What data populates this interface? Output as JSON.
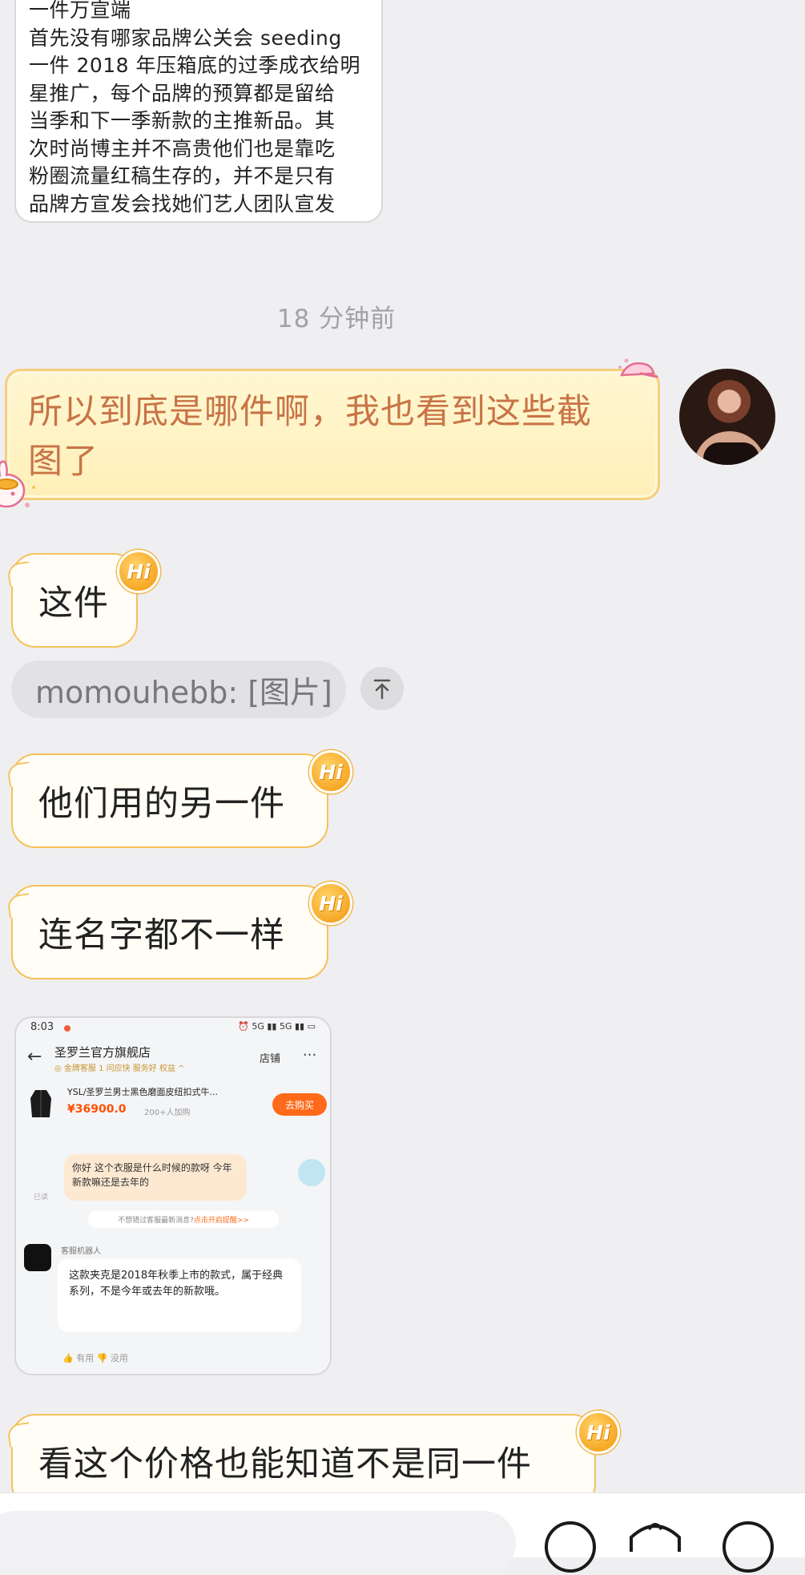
{
  "messages": {
    "screenshot_text_lines": [
      "一件万宣端",
      "首先没有哪家品牌公关会 seeding",
      "一件 2018 年压箱底的过季成衣给明",
      "星推广，每个品牌的预算都是留给",
      "当季和下一季新款的主推新品。其",
      "次时尚博主并不高贵他们也是靠吃",
      "粉圈流量红稿生存的，并不是只有",
      "品牌方宣发会找她们艺人团队宣发"
    ],
    "timestamp": "18 分钟前",
    "outgoing_text": "所以到底是哪件啊，我也看到这些截图了",
    "reply_1": "这件",
    "quote": "momouhebb: [图片]",
    "reply_2": "他们用的另一件",
    "reply_3": "连名字都不一样",
    "reply_4": "看这个价格也能知道不是同一件",
    "hi_badge": "Hi"
  },
  "embedded_screenshot": {
    "time": "8:03",
    "status_icons": "⏰ 5G ▮▮ 5G ▮▮ ▭",
    "shop_name": "圣罗兰官方旗舰店",
    "shop_sub": "◎ 金牌客服 1 问应快 服务好   权益 ^",
    "store_label": "店铺",
    "more": "···",
    "product_name": "YSL/圣罗兰男士黑色磨面皮纽扣式牛...",
    "price": "¥36900.0",
    "sold": "200+人加购",
    "buy_label": "去购买",
    "user_question": "你好 这个衣服是什么时候的款呀 今年新款嘛还是去年的",
    "received": "已读",
    "tip_text": "不想错过客服最新消息? ",
    "tip_link": "点击开启提醒>>",
    "bot_name": "客服机器人",
    "bot_reply": "这款夹克是2018年秋季上市的款式，属于经典系列，不是今年或去年的新款哦。",
    "feedback": "👍 有用    👎 没用"
  },
  "colors": {
    "background": "#efeff1",
    "bubble_border": "#f6c15a",
    "outgoing_text": "#c87446",
    "badge": "#f7a826"
  },
  "icons": [
    "cap-icon",
    "bunny-icon",
    "up-arrow-icon",
    "emoji-icon",
    "gift-icon",
    "plus-icon"
  ]
}
